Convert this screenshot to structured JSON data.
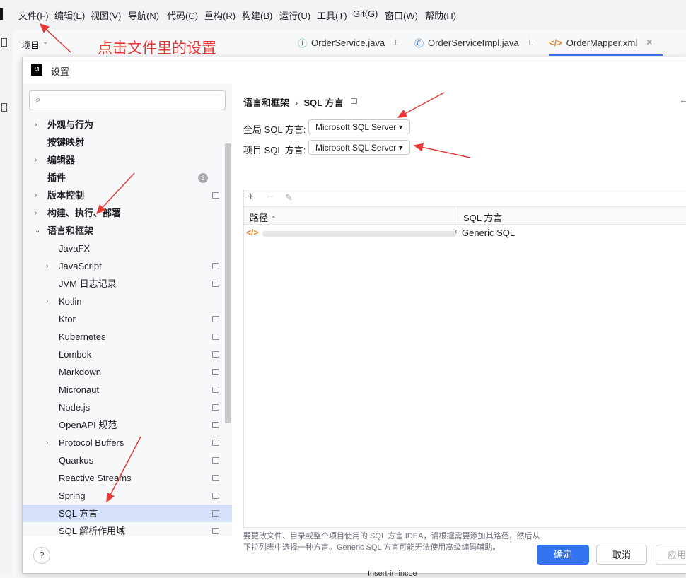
{
  "menubar": {
    "items": [
      "文件(F)",
      "编辑(E)",
      "视图(V)",
      "导航(N)",
      "代码(C)",
      "重构(R)",
      "构建(B)",
      "运行(U)",
      "工具(T)",
      "Git(G)",
      "窗口(W)",
      "帮助(H)"
    ]
  },
  "project": {
    "label": "项目"
  },
  "annotation": {
    "text": "点击文件里的设置",
    "color": "#e53935"
  },
  "editor_tabs": [
    {
      "label": "OrderService.java",
      "icon": "java-class-icon"
    },
    {
      "label": "OrderServiceImpl.java",
      "icon": "java-class-icon"
    },
    {
      "label": "OrderMapper.xml",
      "icon": "xml-icon"
    }
  ],
  "dialog": {
    "title": "设置",
    "search": {
      "placeholder": ""
    },
    "tree": [
      {
        "label": "外观与行为",
        "bold": true,
        "expandable": true
      },
      {
        "label": "按键映射",
        "bold": true
      },
      {
        "label": "编辑器",
        "bold": true,
        "expandable": true
      },
      {
        "label": "插件",
        "bold": true,
        "count": "3"
      },
      {
        "label": "版本控制",
        "bold": true,
        "expandable": true,
        "marker": true
      },
      {
        "label": "构建、执行、部署",
        "bold": true,
        "expandable": true
      },
      {
        "label": "语言和框架",
        "bold": true,
        "expanded": true
      },
      {
        "label": "JavaFX",
        "child": true
      },
      {
        "label": "JavaScript",
        "child": true,
        "expandable": true,
        "marker": true
      },
      {
        "label": "JVM 日志记录",
        "child": true,
        "marker": true
      },
      {
        "label": "Kotlin",
        "child": true,
        "expandable": true
      },
      {
        "label": "Ktor",
        "child": true,
        "marker": true
      },
      {
        "label": "Kubernetes",
        "child": true,
        "marker": true
      },
      {
        "label": "Lombok",
        "child": true,
        "marker": true
      },
      {
        "label": "Markdown",
        "child": true,
        "marker": true
      },
      {
        "label": "Micronaut",
        "child": true,
        "marker": true
      },
      {
        "label": "Node.js",
        "child": true,
        "marker": true
      },
      {
        "label": "OpenAPI 规范",
        "child": true,
        "marker": true
      },
      {
        "label": "Protocol Buffers",
        "child": true,
        "expandable": true,
        "marker": true
      },
      {
        "label": "Quarkus",
        "child": true,
        "marker": true
      },
      {
        "label": "Reactive Streams",
        "child": true,
        "marker": true
      },
      {
        "label": "Spring",
        "child": true,
        "marker": true
      },
      {
        "label": "SQL 方言",
        "child": true,
        "marker": true,
        "selected": true
      },
      {
        "label": "SQL 解析作用域",
        "child": true,
        "marker": true
      }
    ],
    "breadcrumb": {
      "parent": "语言和框架",
      "separator": "›",
      "current": "SQL 方言"
    },
    "global_dialect": {
      "label": "全局 SQL 方言:",
      "value": "Microsoft SQL Server"
    },
    "project_dialect": {
      "label": "项目 SQL 方言:",
      "value": "Microsoft SQL Server"
    },
    "table": {
      "columns": [
        "路径",
        "SQL 方言"
      ],
      "rows": [
        {
          "path_tail": "‹",
          "dialect": "Generic SQL"
        }
      ]
    },
    "help_text": "要更改文件、目录或整个项目使用的 SQL 方言 IDEA，请根据需要添加其路径，然后从下拉列表中选择一种方言。Generic SQL 方言可能无法使用高级编码辅助。",
    "buttons": {
      "help": "?",
      "ok": "确定",
      "cancel": "取消",
      "apply": "应用"
    }
  },
  "bottom_snippet": "Insert-in-incoe"
}
